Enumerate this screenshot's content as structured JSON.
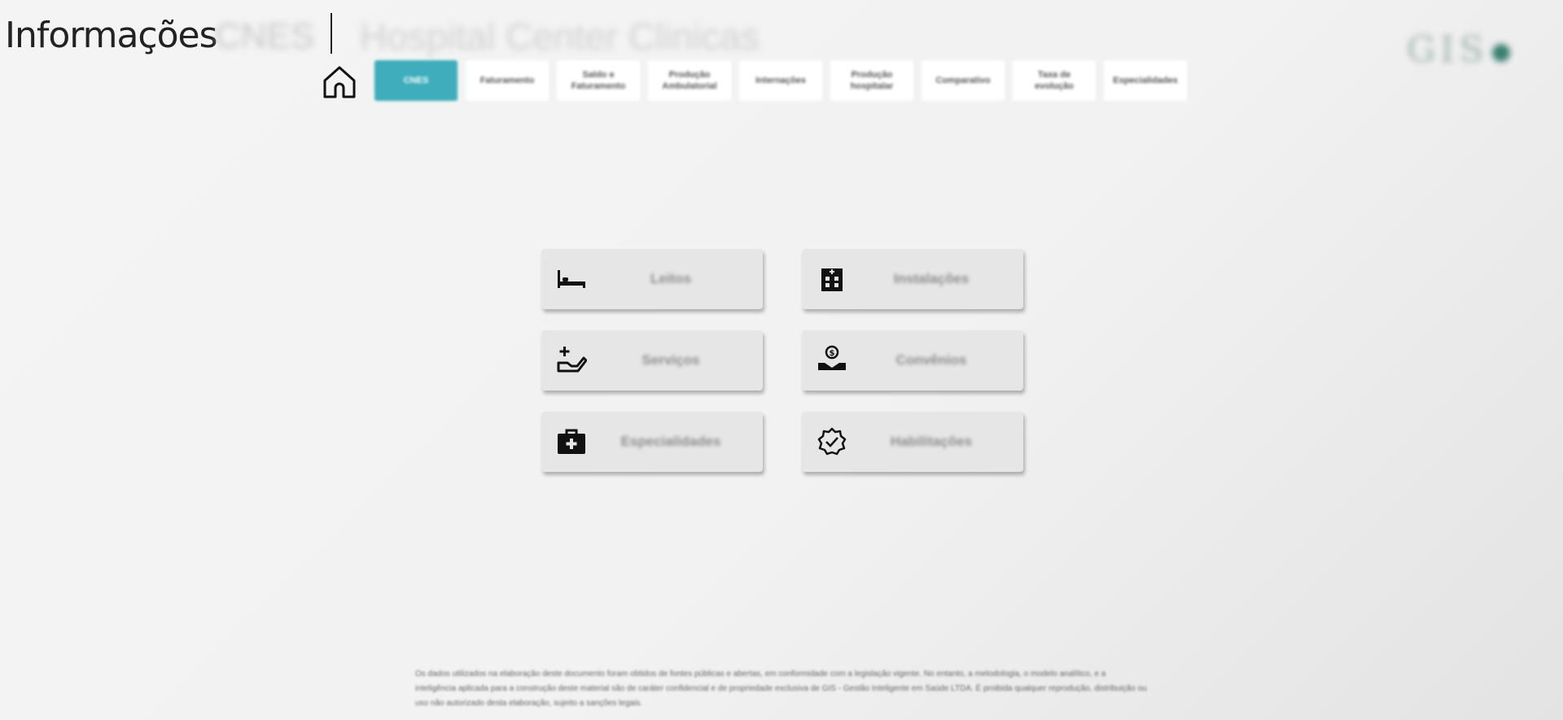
{
  "header": {
    "title": "Informações",
    "code": "CNES",
    "hospital": "Hospital Center Clinicas",
    "logo_text": "GIS"
  },
  "nav": {
    "home_icon": "home-icon",
    "tabs": [
      {
        "label": "CNES",
        "active": true
      },
      {
        "label": "Faturamento",
        "active": false
      },
      {
        "label": "Saldo e Faturamento",
        "active": false
      },
      {
        "label": "Produção Ambulatorial",
        "active": false
      },
      {
        "label": "Internações",
        "active": false
      },
      {
        "label": "Produção hospitalar",
        "active": false
      },
      {
        "label": "Comparativo",
        "active": false
      },
      {
        "label": "Taxa de evolução",
        "active": false
      },
      {
        "label": "Especialidades",
        "active": false
      }
    ]
  },
  "cards": {
    "leitos": {
      "label": "Leitos",
      "icon": "bed-icon"
    },
    "instalacoes": {
      "label": "Instalações",
      "icon": "hospital-building-icon"
    },
    "servicos": {
      "label": "Serviços",
      "icon": "hand-plus-icon"
    },
    "convenios": {
      "label": "Convênios",
      "icon": "hand-coin-icon"
    },
    "especialidades": {
      "label": "Especialidades",
      "icon": "medical-kit-icon"
    },
    "habilitacoes": {
      "label": "Habilitações",
      "icon": "badge-check-icon"
    }
  },
  "footer": {
    "disclaimer": "Os dados utilizados na elaboração deste documento foram obtidos de fontes públicas e abertas, em conformidade com a legislação vigente. No entanto, a metodologia, o modelo analítico, e a inteligência aplicada para a construção deste material são de caráter confidencial e de propriedade exclusiva de GIS - Gestão Inteligente em Saúde LTDA. É proibida qualquer reprodução, distribuição ou uso não autorizado desta elaboração, sujeito a sanções legais."
  },
  "colors": {
    "accent": "#3fadbb",
    "card_bg": "#e6e6e6",
    "logo": "#3a7f72"
  }
}
